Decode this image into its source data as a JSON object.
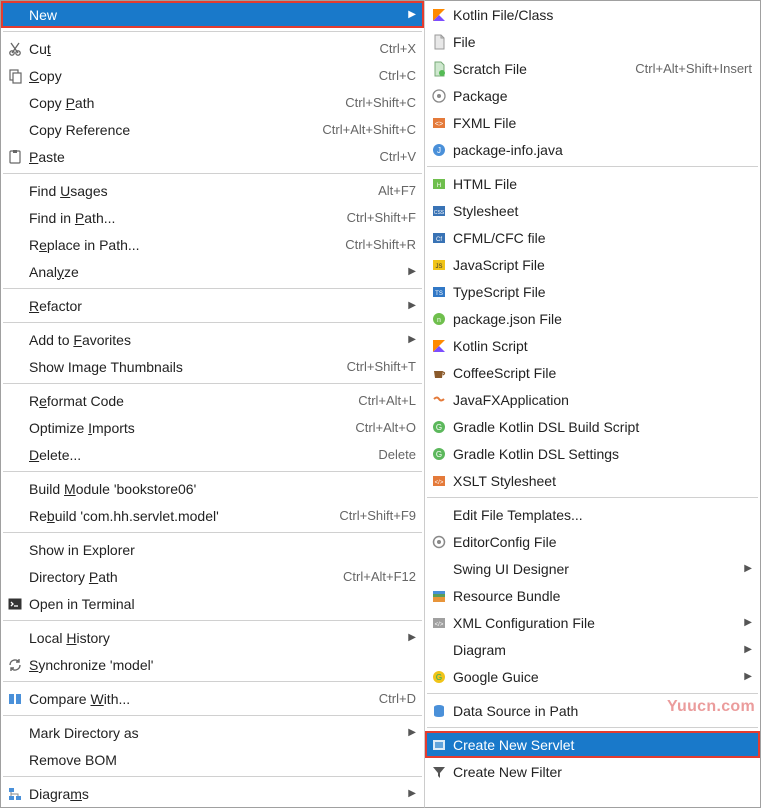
{
  "left": [
    {
      "type": "item",
      "label": "New",
      "shortcut": "",
      "submenu": true,
      "icon": "blank",
      "selected": true,
      "boxed": true,
      "name": "new-item"
    },
    {
      "type": "sep"
    },
    {
      "type": "item",
      "label": "Cut",
      "u": 2,
      "shortcut": "Ctrl+X",
      "icon": "cut",
      "name": "cut-item"
    },
    {
      "type": "item",
      "label": "Copy",
      "u": 0,
      "shortcut": "Ctrl+C",
      "icon": "copy",
      "name": "copy-item"
    },
    {
      "type": "item",
      "label": "Copy Path",
      "u": 5,
      "shortcut": "Ctrl+Shift+C",
      "icon": "blank",
      "name": "copy-path-item"
    },
    {
      "type": "item",
      "label": "Copy Reference",
      "shortcut": "Ctrl+Alt+Shift+C",
      "icon": "blank",
      "name": "copy-reference-item"
    },
    {
      "type": "item",
      "label": "Paste",
      "u": 0,
      "shortcut": "Ctrl+V",
      "icon": "paste",
      "name": "paste-item"
    },
    {
      "type": "sep"
    },
    {
      "type": "item",
      "label": "Find Usages",
      "u": 5,
      "shortcut": "Alt+F7",
      "icon": "blank",
      "name": "find-usages-item"
    },
    {
      "type": "item",
      "label": "Find in Path...",
      "u": 8,
      "shortcut": "Ctrl+Shift+F",
      "icon": "blank",
      "name": "find-in-path-item"
    },
    {
      "type": "item",
      "label": "Replace in Path...",
      "u": 1,
      "shortcut": "Ctrl+Shift+R",
      "icon": "blank",
      "name": "replace-in-path-item"
    },
    {
      "type": "item",
      "label": "Analyze",
      "u": 4,
      "shortcut": "",
      "submenu": true,
      "icon": "blank",
      "name": "analyze-item"
    },
    {
      "type": "sep"
    },
    {
      "type": "item",
      "label": "Refactor",
      "u": 0,
      "shortcut": "",
      "submenu": true,
      "icon": "blank",
      "name": "refactor-item"
    },
    {
      "type": "sep"
    },
    {
      "type": "item",
      "label": "Add to Favorites",
      "u": 7,
      "shortcut": "",
      "submenu": true,
      "icon": "blank",
      "name": "add-favorites-item"
    },
    {
      "type": "item",
      "label": "Show Image Thumbnails",
      "shortcut": "Ctrl+Shift+T",
      "icon": "blank",
      "name": "show-thumbnails-item"
    },
    {
      "type": "sep"
    },
    {
      "type": "item",
      "label": "Reformat Code",
      "u": 1,
      "shortcut": "Ctrl+Alt+L",
      "icon": "blank",
      "name": "reformat-code-item"
    },
    {
      "type": "item",
      "label": "Optimize Imports",
      "u": 9,
      "shortcut": "Ctrl+Alt+O",
      "icon": "blank",
      "name": "optimize-imports-item"
    },
    {
      "type": "item",
      "label": "Delete...",
      "u": 0,
      "shortcut": "Delete",
      "icon": "blank",
      "name": "delete-item"
    },
    {
      "type": "sep"
    },
    {
      "type": "item",
      "label": "Build Module 'bookstore06'",
      "u": 6,
      "shortcut": "",
      "icon": "blank",
      "name": "build-module-item"
    },
    {
      "type": "item",
      "label": "Rebuild 'com.hh.servlet.model'",
      "u": 2,
      "shortcut": "Ctrl+Shift+F9",
      "icon": "blank",
      "name": "rebuild-item"
    },
    {
      "type": "sep"
    },
    {
      "type": "item",
      "label": "Show in Explorer",
      "shortcut": "",
      "icon": "blank",
      "name": "show-explorer-item"
    },
    {
      "type": "item",
      "label": "Directory Path",
      "u": 10,
      "shortcut": "Ctrl+Alt+F12",
      "icon": "blank",
      "name": "directory-path-item"
    },
    {
      "type": "item",
      "label": "Open in Terminal",
      "shortcut": "",
      "icon": "terminal",
      "name": "open-terminal-item"
    },
    {
      "type": "sep"
    },
    {
      "type": "item",
      "label": "Local History",
      "u": 6,
      "shortcut": "",
      "submenu": true,
      "icon": "blank",
      "name": "local-history-item"
    },
    {
      "type": "item",
      "label": "Synchronize 'model'",
      "u": 0,
      "shortcut": "",
      "icon": "sync",
      "name": "synchronize-item"
    },
    {
      "type": "sep"
    },
    {
      "type": "item",
      "label": "Compare With...",
      "u": 8,
      "shortcut": "Ctrl+D",
      "icon": "compare",
      "name": "compare-item"
    },
    {
      "type": "sep"
    },
    {
      "type": "item",
      "label": "Mark Directory as",
      "shortcut": "",
      "submenu": true,
      "icon": "blank",
      "name": "mark-directory-item"
    },
    {
      "type": "item",
      "label": "Remove BOM",
      "shortcut": "",
      "icon": "blank",
      "name": "remove-bom-item"
    },
    {
      "type": "sep"
    },
    {
      "type": "item",
      "label": "Diagrams",
      "u": 6,
      "shortcut": "",
      "submenu": true,
      "icon": "diagrams",
      "name": "diagrams-item"
    }
  ],
  "right": [
    {
      "type": "item",
      "label": "Kotlin File/Class",
      "icon": "kotlin",
      "name": "kotlin-file-item"
    },
    {
      "type": "item",
      "label": "File",
      "icon": "file",
      "name": "file-item"
    },
    {
      "type": "item",
      "label": "Scratch File",
      "shortcut": "Ctrl+Alt+Shift+Insert",
      "icon": "scratch",
      "name": "scratch-file-item"
    },
    {
      "type": "item",
      "label": "Package",
      "icon": "package",
      "name": "package-item"
    },
    {
      "type": "item",
      "label": "FXML File",
      "icon": "fxml",
      "name": "fxml-file-item"
    },
    {
      "type": "item",
      "label": "package-info.java",
      "icon": "java",
      "name": "package-info-item"
    },
    {
      "type": "sep"
    },
    {
      "type": "item",
      "label": "HTML File",
      "icon": "html",
      "name": "html-file-item"
    },
    {
      "type": "item",
      "label": "Stylesheet",
      "icon": "css",
      "name": "stylesheet-item"
    },
    {
      "type": "item",
      "label": "CFML/CFC file",
      "icon": "cfml",
      "name": "cfml-file-item"
    },
    {
      "type": "item",
      "label": "JavaScript File",
      "icon": "js",
      "name": "javascript-file-item"
    },
    {
      "type": "item",
      "label": "TypeScript File",
      "icon": "ts",
      "name": "typescript-file-item"
    },
    {
      "type": "item",
      "label": "package.json File",
      "icon": "pkgjson",
      "name": "package-json-item"
    },
    {
      "type": "item",
      "label": "Kotlin Script",
      "icon": "kotlin",
      "name": "kotlin-script-item"
    },
    {
      "type": "item",
      "label": "CoffeeScript File",
      "icon": "coffee",
      "name": "coffeescript-item"
    },
    {
      "type": "item",
      "label": "JavaFXApplication",
      "icon": "javafx",
      "name": "javafx-app-item"
    },
    {
      "type": "item",
      "label": "Gradle Kotlin DSL Build Script",
      "icon": "gradle",
      "name": "gradle-build-item"
    },
    {
      "type": "item",
      "label": "Gradle Kotlin DSL Settings",
      "icon": "gradle",
      "name": "gradle-settings-item"
    },
    {
      "type": "item",
      "label": "XSLT Stylesheet",
      "icon": "xslt",
      "name": "xslt-stylesheet-item"
    },
    {
      "type": "sep"
    },
    {
      "type": "item",
      "label": "Edit File Templates...",
      "icon": "blank",
      "name": "edit-templates-item"
    },
    {
      "type": "item",
      "label": "EditorConfig File",
      "icon": "editorconfig",
      "name": "editorconfig-item"
    },
    {
      "type": "item",
      "label": "Swing UI Designer",
      "submenu": true,
      "icon": "blank",
      "name": "swing-designer-item"
    },
    {
      "type": "item",
      "label": "Resource Bundle",
      "icon": "bundle",
      "name": "resource-bundle-item"
    },
    {
      "type": "item",
      "label": "XML Configuration File",
      "submenu": true,
      "icon": "xml",
      "name": "xml-config-item"
    },
    {
      "type": "item",
      "label": "Diagram",
      "submenu": true,
      "icon": "blank",
      "name": "diagram-item"
    },
    {
      "type": "item",
      "label": "Google Guice",
      "submenu": true,
      "icon": "guice",
      "name": "google-guice-item"
    },
    {
      "type": "sep"
    },
    {
      "type": "item",
      "label": "Data Source in Path",
      "icon": "datasource",
      "name": "datasource-item"
    },
    {
      "type": "sep"
    },
    {
      "type": "item",
      "label": "Create New Servlet",
      "icon": "servlet",
      "name": "create-servlet-item",
      "selected": true,
      "boxed": true
    },
    {
      "type": "item",
      "label": "Create New Filter",
      "icon": "filter",
      "name": "create-filter-item"
    }
  ],
  "watermark": "Yuucn.com"
}
